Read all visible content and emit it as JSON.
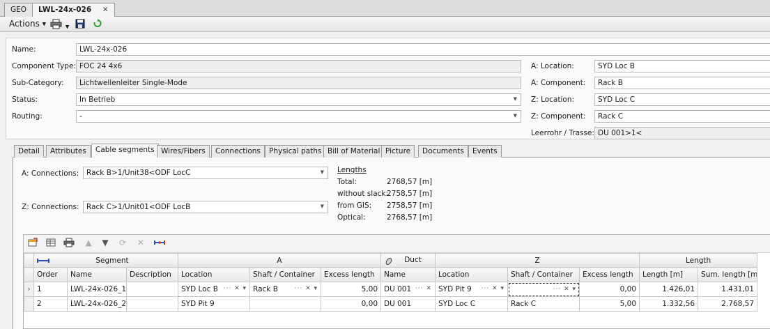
{
  "doc_tabs": [
    {
      "label": "GEO",
      "active": false
    },
    {
      "label": "LWL-24x-026",
      "active": true,
      "close": "✕"
    }
  ],
  "toolbar": {
    "actions_label": "Actions",
    "icons": [
      "printer-icon",
      "save-icon",
      "refresh-icon"
    ]
  },
  "form": {
    "name_label": "Name:",
    "name_value": "LWL-24x-026",
    "component_type_label": "Component Type:",
    "component_type_value": "FOC 24 4x6",
    "sub_category_label": "Sub-Category:",
    "sub_category_value": "Lichtwellenleiter Single-Mode",
    "status_label": "Status:",
    "status_value": "In Betrieb",
    "routing_label": "Routing:",
    "routing_value": "-",
    "a_location_label": "A: Location:",
    "a_location_value": "SYD Loc B",
    "a_component_label": "A: Component:",
    "a_component_value": "Rack B",
    "z_location_label": "Z: Location:",
    "z_location_value": "SYD Loc C",
    "z_component_label": "Z: Component:",
    "z_component_value": "Rack C",
    "leerrohr_label": "Leerrohr / Trasse:",
    "leerrohr_value": "DU 001>1<"
  },
  "inner_tabs": [
    {
      "label": "Detail",
      "active": false
    },
    {
      "label": "Attributes",
      "active": false
    },
    {
      "label": "Cable segments",
      "active": true
    },
    {
      "label": "Wires/Fibers",
      "active": false
    },
    {
      "label": "Connections",
      "active": false
    },
    {
      "label": "Physical paths",
      "active": false
    },
    {
      "label": "Bill of Material",
      "active": false
    },
    {
      "label": "Picture",
      "active": false
    },
    {
      "label": "Documents",
      "active": false
    },
    {
      "label": "Events",
      "active": false
    }
  ],
  "connections": {
    "a_label": "A: Connections:",
    "a_value": "Rack B>1/Unit38<ODF LocC",
    "z_label": "Z: Connections:",
    "z_value": "Rack C>1/Unit01<ODF LocB"
  },
  "lengths": {
    "title": "Lengths",
    "rows": [
      {
        "key": "Total:",
        "value": "2768,57 [m]"
      },
      {
        "key": "without slack:",
        "value": "2758,57 [m]"
      },
      {
        "key": "from GIS:",
        "value": "2758,57 [m]"
      },
      {
        "key": "Optical:",
        "value": "2768,57 [m]"
      }
    ]
  },
  "grid": {
    "groups": [
      "Segment",
      "A",
      "Duct",
      "Z",
      "Length"
    ],
    "columns": [
      "Order",
      "Name",
      "Description",
      "Location",
      "Shaft / Container",
      "Excess length",
      "Name",
      "Location",
      "Shaft / Container",
      "Excess length",
      "Length [m]",
      "Sum. length [m]"
    ],
    "rows": [
      [
        "1",
        "LWL-24x-026_1",
        "",
        "SYD Loc B",
        "Rack B",
        "5,00",
        "DU 001",
        "SYD Pit 9",
        "",
        "0,00",
        "1.426,01",
        "1.431,01"
      ],
      [
        "2",
        "LWL-24x-026_2",
        "",
        "SYD Pit 9",
        "",
        "0,00",
        "DU 001",
        "SYD Loc C",
        "Rack C",
        "5,00",
        "1.332,56",
        "2.768,57"
      ]
    ],
    "current_row_marker": "›"
  }
}
